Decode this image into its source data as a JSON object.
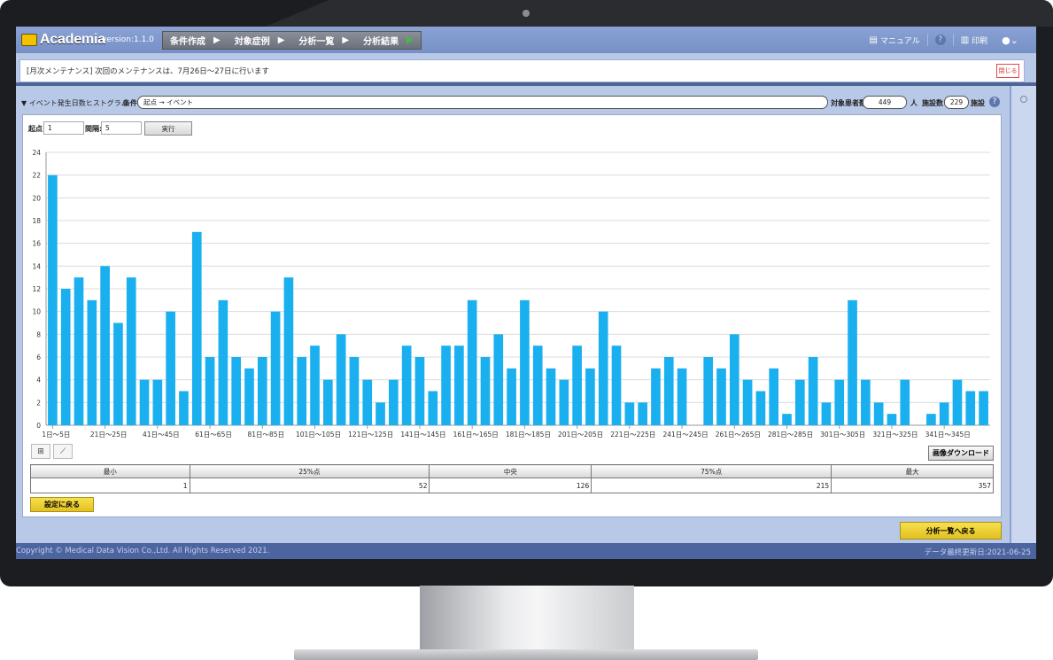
{
  "app": {
    "name": "Academia",
    "version": "version:1.1.0"
  },
  "steps": [
    {
      "label": "条件作成"
    },
    {
      "label": "対象症例"
    },
    {
      "label": "分析一覧"
    },
    {
      "label": "分析結果"
    }
  ],
  "toolbar": {
    "manual_label": "マニュアル",
    "help_label": "?",
    "print_label": "印刷"
  },
  "notice": {
    "text": "[月次メンテナンス] 次回のメンテナンスは、7月26日～27日に行います",
    "close_label": "閉じる"
  },
  "condition": {
    "section_title": "▼ イベント発生日数ヒストグラム",
    "label": "条件",
    "value": "起点 → イベント",
    "patients_label": "対象患者数",
    "patients_value": "449",
    "patients_unit": "人",
    "facilities_label": "施設数",
    "facilities_value": "229",
    "facilities_unit": "施設"
  },
  "params": {
    "start_label": "起点:",
    "start_value": "1",
    "interval_label": "間隔:",
    "interval_value": "5",
    "run_label": "実行"
  },
  "chart_data": {
    "type": "bar",
    "title": "",
    "xlabel": "",
    "ylabel": "",
    "ylim": [
      0,
      24
    ],
    "yticks": [
      0,
      2,
      4,
      6,
      8,
      10,
      12,
      14,
      16,
      18,
      20,
      22,
      24
    ],
    "grid": true,
    "bar_color": "#1ab0f0",
    "categories": [
      "1日～5日",
      "6日～10日",
      "11日～15日",
      "16日～20日",
      "21日～25日",
      "26日～30日",
      "31日～35日",
      "36日～40日",
      "41日～45日",
      "46日～50日",
      "51日～55日",
      "56日～60日",
      "61日～65日",
      "66日～70日",
      "71日～75日",
      "76日～80日",
      "81日～85日",
      "86日～90日",
      "91日～95日",
      "96日～100日",
      "101日～105日",
      "106日～110日",
      "111日～115日",
      "116日～120日",
      "121日～125日",
      "126日～130日",
      "131日～135日",
      "136日～140日",
      "141日～145日",
      "146日～150日",
      "151日～155日",
      "156日～160日",
      "161日～165日",
      "166日～170日",
      "171日～175日",
      "176日～180日",
      "181日～185日",
      "186日～190日",
      "191日～195日",
      "196日～200日",
      "201日～205日",
      "206日～210日",
      "211日～215日",
      "216日～220日",
      "221日～225日",
      "226日～230日",
      "231日～235日",
      "236日～240日",
      "241日～245日",
      "246日～250日",
      "251日～255日",
      "256日～260日",
      "261日～265日",
      "266日～270日",
      "271日～275日",
      "276日～280日",
      "281日～285日",
      "286日～290日",
      "291日～295日",
      "296日～300日",
      "301日～305日",
      "306日～310日",
      "311日～315日",
      "316日～320日",
      "321日～325日",
      "326日～330日",
      "331日～335日",
      "336日～340日",
      "341日～345日",
      "346日～350日",
      "351日～355日",
      "356日～360日"
    ],
    "tick_labels": [
      {
        "index": 0,
        "label": "1日～5日"
      },
      {
        "index": 4,
        "label": "21日～25日"
      },
      {
        "index": 8,
        "label": "41日～45日"
      },
      {
        "index": 12,
        "label": "61日～65日"
      },
      {
        "index": 16,
        "label": "81日～85日"
      },
      {
        "index": 20,
        "label": "101日～105日"
      },
      {
        "index": 24,
        "label": "121日～125日"
      },
      {
        "index": 28,
        "label": "141日～145日"
      },
      {
        "index": 32,
        "label": "161日～165日"
      },
      {
        "index": 36,
        "label": "181日～185日"
      },
      {
        "index": 40,
        "label": "201日～205日"
      },
      {
        "index": 44,
        "label": "221日～225日"
      },
      {
        "index": 48,
        "label": "241日～245日"
      },
      {
        "index": 52,
        "label": "261日～265日"
      },
      {
        "index": 56,
        "label": "281日～285日"
      },
      {
        "index": 60,
        "label": "301日～305日"
      },
      {
        "index": 64,
        "label": "321日～325日"
      },
      {
        "index": 68,
        "label": "341日～345日"
      }
    ],
    "values": [
      22,
      12,
      13,
      11,
      14,
      9,
      13,
      4,
      4,
      10,
      3,
      17,
      6,
      11,
      6,
      5,
      6,
      10,
      13,
      6,
      7,
      4,
      8,
      6,
      4,
      2,
      4,
      7,
      6,
      3,
      7,
      7,
      11,
      6,
      8,
      5,
      11,
      7,
      5,
      4,
      7,
      5,
      10,
      7,
      2,
      2,
      5,
      6,
      5,
      0,
      6,
      5,
      8,
      4,
      3,
      5,
      1,
      4,
      6,
      2,
      4,
      11,
      4,
      2,
      1,
      4,
      0,
      1,
      2,
      4,
      3,
      3
    ]
  },
  "chart_tools": {
    "table_icon": "grid-icon",
    "chart_icon": "line-chart-icon",
    "download_label": "画像ダウンロード"
  },
  "stats": {
    "headers": [
      "最小",
      "25%点",
      "中央",
      "75%点",
      "最大"
    ],
    "values": [
      "1",
      "52",
      "126",
      "215",
      "357"
    ]
  },
  "buttons": {
    "back_to_settings": "設定に戻る",
    "back_to_list": "分析一覧へ戻る"
  },
  "footer": {
    "copyright": "Copyright © Medical Data Vision Co.,Ltd. All Rights Reserved 2021.",
    "updated": "データ最終更新日:2021-06-25"
  }
}
